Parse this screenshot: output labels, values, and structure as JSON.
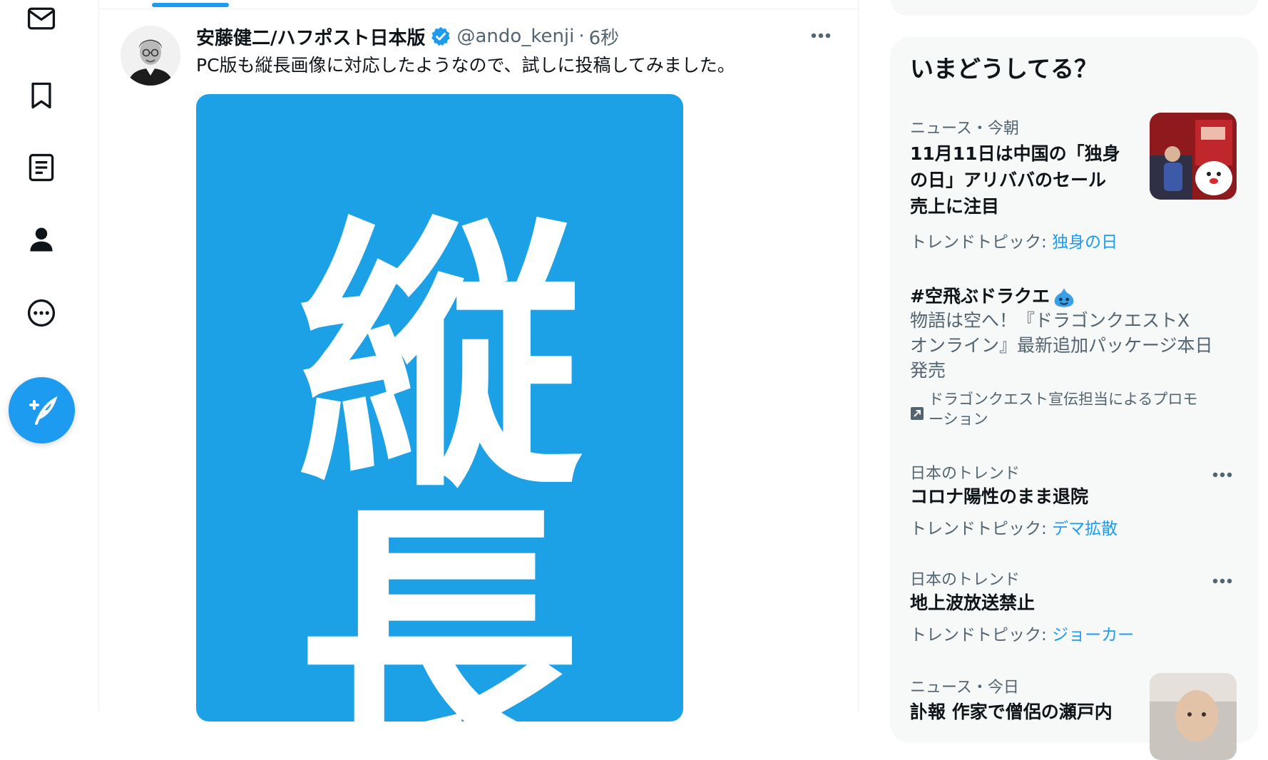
{
  "nav": {
    "items": [
      {
        "name": "messages",
        "icon": "mail-icon"
      },
      {
        "name": "bookmarks",
        "icon": "bookmark-icon"
      },
      {
        "name": "lists",
        "icon": "list-icon"
      },
      {
        "name": "profile",
        "icon": "person-icon"
      },
      {
        "name": "more",
        "icon": "more-circle-icon"
      }
    ],
    "compose_icon": "feather-plus-icon"
  },
  "tweet": {
    "author_name": "安藤健二/ハフポスト日本版",
    "handle": "@ando_kenji",
    "separator": "·",
    "time": "6秒",
    "text": "PC版も縦長画像に対応したようなので、試しに投稿してみました。",
    "media": {
      "chars": [
        "縦",
        "長"
      ],
      "background": "#1da1e6"
    }
  },
  "trends": {
    "title": "いまどうしてる？",
    "items": [
      {
        "meta": "ニュース・今朝",
        "title_lines": [
          "11月11日は中国の「独身",
          "の日」アリババのセール",
          "売上に注目"
        ],
        "topic_prefix": "トレンドトピック:",
        "topic_link": "独身の日"
      },
      {
        "title": "#空飛ぶドラクエ",
        "desc_lines": [
          "物語は空へ！『ドラゴンクエストX",
          "オンライン』最新追加パッケージ本日",
          "発売"
        ],
        "promo_lines": [
          "ドラゴンクエスト宣伝担当によるプロモ",
          "ーション"
        ]
      },
      {
        "meta": "日本のトレンド",
        "title": "コロナ陽性のまま退院",
        "topic_prefix": "トレンドトピック:",
        "topic_link": "デマ拡散"
      },
      {
        "meta": "日本のトレンド",
        "title": "地上波放送禁止",
        "topic_prefix": "トレンドトピック:",
        "topic_link": "ジョーカー"
      },
      {
        "meta": "ニュース・今日",
        "title": "訃報 作家で僧侶の瀬戸内"
      }
    ]
  },
  "colors": {
    "accent": "#1d9bf0",
    "text": "#0f1419",
    "secondary": "#536471",
    "panel": "#f7f9f9"
  }
}
